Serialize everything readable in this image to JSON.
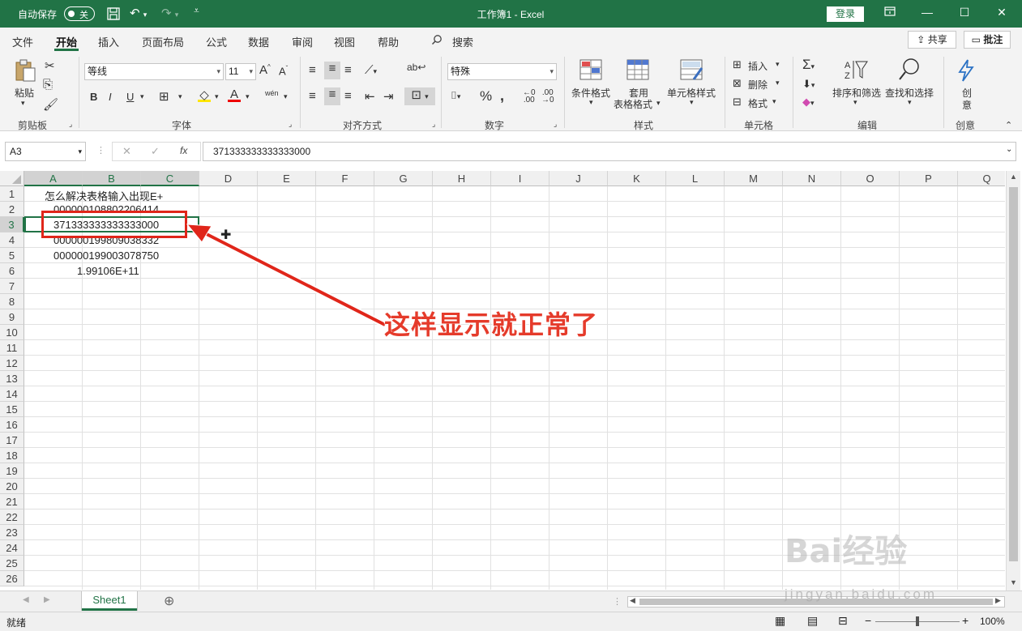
{
  "titlebar": {
    "autosave_label": "自动保存",
    "autosave_state": "关",
    "title": "工作簿1  -  Excel",
    "login": "登录"
  },
  "tabs": [
    "文件",
    "开始",
    "插入",
    "页面布局",
    "公式",
    "数据",
    "审阅",
    "视图",
    "帮助"
  ],
  "search_label": "搜索",
  "share_label": "共享",
  "comment_label": "批注",
  "ribbon": {
    "clipboard": {
      "paste": "粘贴",
      "group": "剪贴板"
    },
    "font": {
      "name": "等线",
      "size": "11",
      "bold": "B",
      "italic": "I",
      "underline": "U",
      "phonetic": "wén",
      "group": "字体"
    },
    "alignment": {
      "group": "对齐方式"
    },
    "number": {
      "format": "特殊",
      "group": "数字"
    },
    "styles": {
      "conditional": "条件格式",
      "table1": "套用",
      "table2": "表格格式",
      "cell_styles": "单元格样式",
      "group": "样式"
    },
    "cells": {
      "insert": "插入",
      "delete": "删除",
      "format": "格式",
      "group": "单元格"
    },
    "editing": {
      "sort": "排序和筛选",
      "find": "查找和选择",
      "group": "编辑"
    },
    "ideas": {
      "label1": "创",
      "label2": "意",
      "group": "创意"
    }
  },
  "formula_bar": {
    "name_box": "A3",
    "fx": "fx",
    "value": "371333333333333000"
  },
  "columns": [
    "A",
    "B",
    "C",
    "D",
    "E",
    "F",
    "G",
    "H",
    "I",
    "J",
    "K",
    "L",
    "M",
    "N",
    "O",
    "P",
    "Q"
  ],
  "rows": [
    "1",
    "2",
    "3",
    "4",
    "5",
    "6",
    "7",
    "8",
    "9",
    "10",
    "11",
    "12",
    "13",
    "14",
    "15",
    "16",
    "17",
    "18",
    "19",
    "20",
    "21",
    "22",
    "23",
    "24",
    "25",
    "26"
  ],
  "cells": {
    "a1": "怎么解决表格输入出现E+",
    "a2": "000000108802206414",
    "a3": "371333333333333000",
    "a4": "000000199809038332",
    "a5": "000000199003078750",
    "a6": "1.99106E+11"
  },
  "sheet_tab": "Sheet1",
  "status": "就绪",
  "zoom": "100%",
  "annotation": "这样显示就正常了",
  "watermark": {
    "brand": "Bai经验",
    "url": "jingyan.baidu.com"
  },
  "colors": {
    "excel_green": "#217346",
    "annotation_red": "#e53b2b"
  }
}
